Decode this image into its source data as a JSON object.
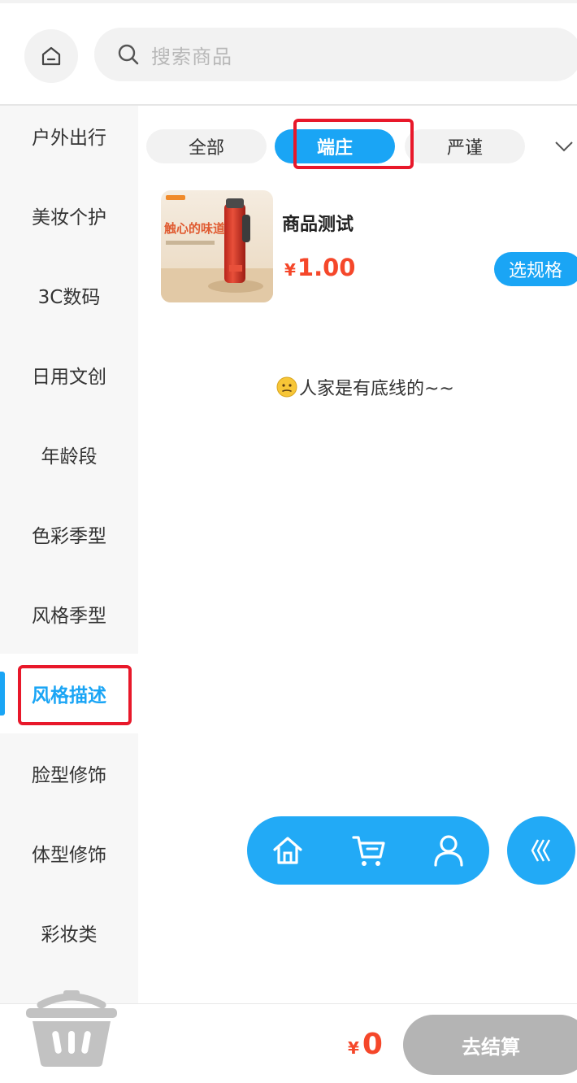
{
  "search": {
    "placeholder": "搜索商品"
  },
  "sidebar": {
    "items": [
      {
        "label": "户外出行",
        "active": false
      },
      {
        "label": "美妆个护",
        "active": false
      },
      {
        "label": "3C数码",
        "active": false
      },
      {
        "label": "日用文创",
        "active": false
      },
      {
        "label": "年龄段",
        "active": false
      },
      {
        "label": "色彩季型",
        "active": false
      },
      {
        "label": "风格季型",
        "active": false
      },
      {
        "label": "风格描述",
        "active": true
      },
      {
        "label": "脸型修饰",
        "active": false
      },
      {
        "label": "体型修饰",
        "active": false
      },
      {
        "label": "彩妆类",
        "active": false
      }
    ]
  },
  "tabs": [
    {
      "label": "全部",
      "active": false
    },
    {
      "label": "端庄",
      "active": true
    },
    {
      "label": "严谨",
      "active": false
    }
  ],
  "product": {
    "name": "商品测试",
    "currency": "¥",
    "price": "1.00",
    "spec_button": "选规格",
    "image_text": "触心的味道"
  },
  "empty_tip": "人家是有底线的~~",
  "float_nav": {
    "icons": [
      "home-icon",
      "cart-icon",
      "user-icon"
    ],
    "toggle_icon": "collapse-arrows-icon"
  },
  "cart": {
    "currency": "¥",
    "total": "0",
    "checkout_label": "去结算"
  },
  "colors": {
    "accent": "#1aa5f5",
    "price": "#f5472a",
    "highlight": "#e8182a",
    "disabled": "#b4b4b4"
  }
}
